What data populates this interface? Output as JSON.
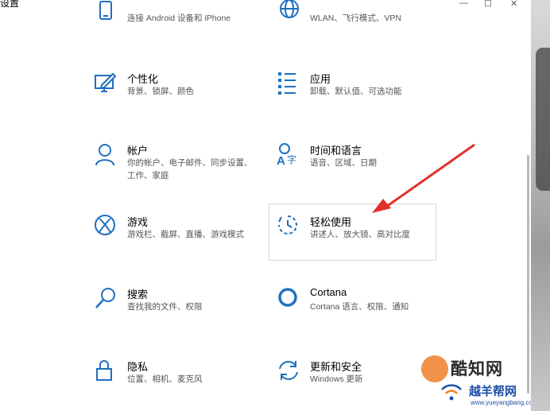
{
  "window": {
    "title": "设置",
    "controls": {
      "minimize": "—",
      "maximize": "☐",
      "close": "✕"
    }
  },
  "tiles": [
    {
      "id": "phone",
      "name": "",
      "desc": "连接 Android 设备和 iPhone",
      "icon": "phone-icon"
    },
    {
      "id": "network",
      "name": "",
      "desc": "WLAN、飞行模式、VPN",
      "icon": "globe-icon"
    },
    {
      "id": "personalization",
      "name": "个性化",
      "desc": "背景、锁屏、颜色",
      "icon": "personalization-icon"
    },
    {
      "id": "apps",
      "name": "应用",
      "desc": "卸载、默认值、可选功能",
      "icon": "apps-list-icon"
    },
    {
      "id": "accounts",
      "name": "帐户",
      "desc": "你的帐户、电子邮件、同步设置、",
      "desc2": "工作、家庭",
      "icon": "person-icon"
    },
    {
      "id": "time-language",
      "name": "时间和语言",
      "desc": "语音、区域、日期",
      "icon": "time-language-icon"
    },
    {
      "id": "gaming",
      "name": "游戏",
      "desc": "游戏栏、截屏、直播、游戏模式",
      "icon": "xbox-icon"
    },
    {
      "id": "ease-of-access",
      "name": "轻松使用",
      "desc": "讲述人、放大镜、高对比度",
      "icon": "ease-of-access-icon"
    },
    {
      "id": "search",
      "name": "搜索",
      "desc": "查找我的文件、权限",
      "icon": "search-icon"
    },
    {
      "id": "cortana",
      "name": "Cortana",
      "desc": "Cortana 语言、权限、通知",
      "icon": "cortana-icon"
    },
    {
      "id": "privacy",
      "name": "隐私",
      "desc": "位置、相机、麦克风",
      "icon": "lock-icon"
    },
    {
      "id": "update-security",
      "name": "更新和安全",
      "desc": "Windows 更新",
      "icon": "sync-icon"
    }
  ],
  "annotation": {
    "arrow_color": "#e0312a"
  },
  "watermark": {
    "brand1": "酷知网",
    "brand2": "越羊帮网",
    "url": "www.yueyangbang.com"
  },
  "colors": {
    "accent": "#0063b1",
    "icon": "#1e70c1"
  }
}
